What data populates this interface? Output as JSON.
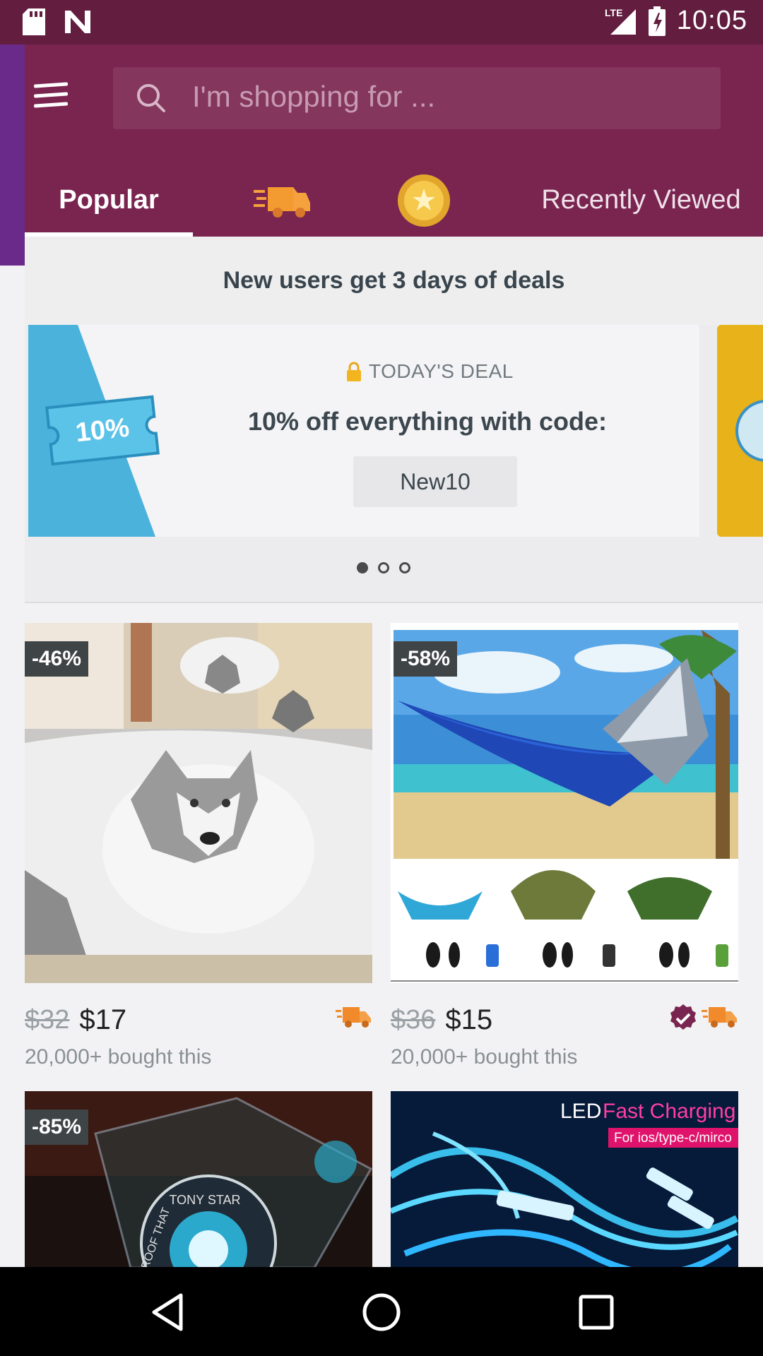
{
  "status_bar": {
    "network": "LTE",
    "time": "10:05"
  },
  "search": {
    "placeholder": "I'm shopping for ..."
  },
  "tabs": [
    {
      "label": "Popular",
      "icon": null,
      "selected": true
    },
    {
      "label": "",
      "icon": "truck-icon"
    },
    {
      "label": "",
      "icon": "coin-icon"
    },
    {
      "label": "Recently Viewed",
      "icon": null
    }
  ],
  "promo": {
    "headline": "New users get 3 days of deals",
    "ticket_text": "10%",
    "tag": "TODAY'S DEAL",
    "title": "10% off everything with code:",
    "code": "New10",
    "page_count": 3,
    "active_page": 1
  },
  "products": [
    {
      "discount": "-46%",
      "old_price": "$32",
      "price": "$17",
      "bought": "20,000+ bought this",
      "free_shipping": true,
      "verified": false,
      "image": "wolf bedding set"
    },
    {
      "discount": "-58%",
      "old_price": "$36",
      "price": "$15",
      "bought": "20,000+ bought this",
      "free_shipping": true,
      "verified": true,
      "image": "camping hammock"
    },
    {
      "discount": "-85%",
      "image": "arc reactor display",
      "image_text": [
        "TONY STAR",
        "ROOF THAT"
      ]
    },
    {
      "discount": "",
      "image": "LED charging cable",
      "image_text": [
        "LED",
        "Fast Charging",
        "For ios/type-c/mirco"
      ]
    }
  ],
  "colors": {
    "status_bar": "#621d3f",
    "header": "#7a2550",
    "accent_orange": "#f08a2a",
    "badge": "#3f4447"
  }
}
